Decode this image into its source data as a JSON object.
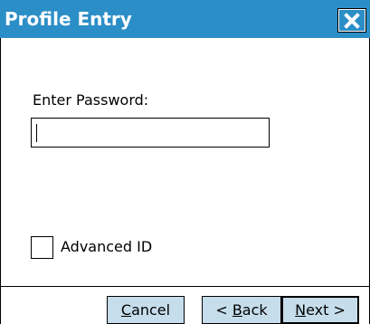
{
  "window": {
    "title": "Profile Entry"
  },
  "form": {
    "password_label": "Enter Password:",
    "password_value": "",
    "advanced_id_label": "Advanced ID",
    "advanced_id_checked": false
  },
  "buttons": {
    "cancel": {
      "access_key": "C",
      "rest": "ancel"
    },
    "back": {
      "prefix": "< ",
      "access_key": "B",
      "rest": "ack"
    },
    "next": {
      "access_key": "N",
      "rest": "ext >"
    }
  },
  "colors": {
    "title_bar": "#2c8ec7",
    "button_face": "#c6ddeb"
  },
  "icons": {
    "close": "close-icon"
  }
}
